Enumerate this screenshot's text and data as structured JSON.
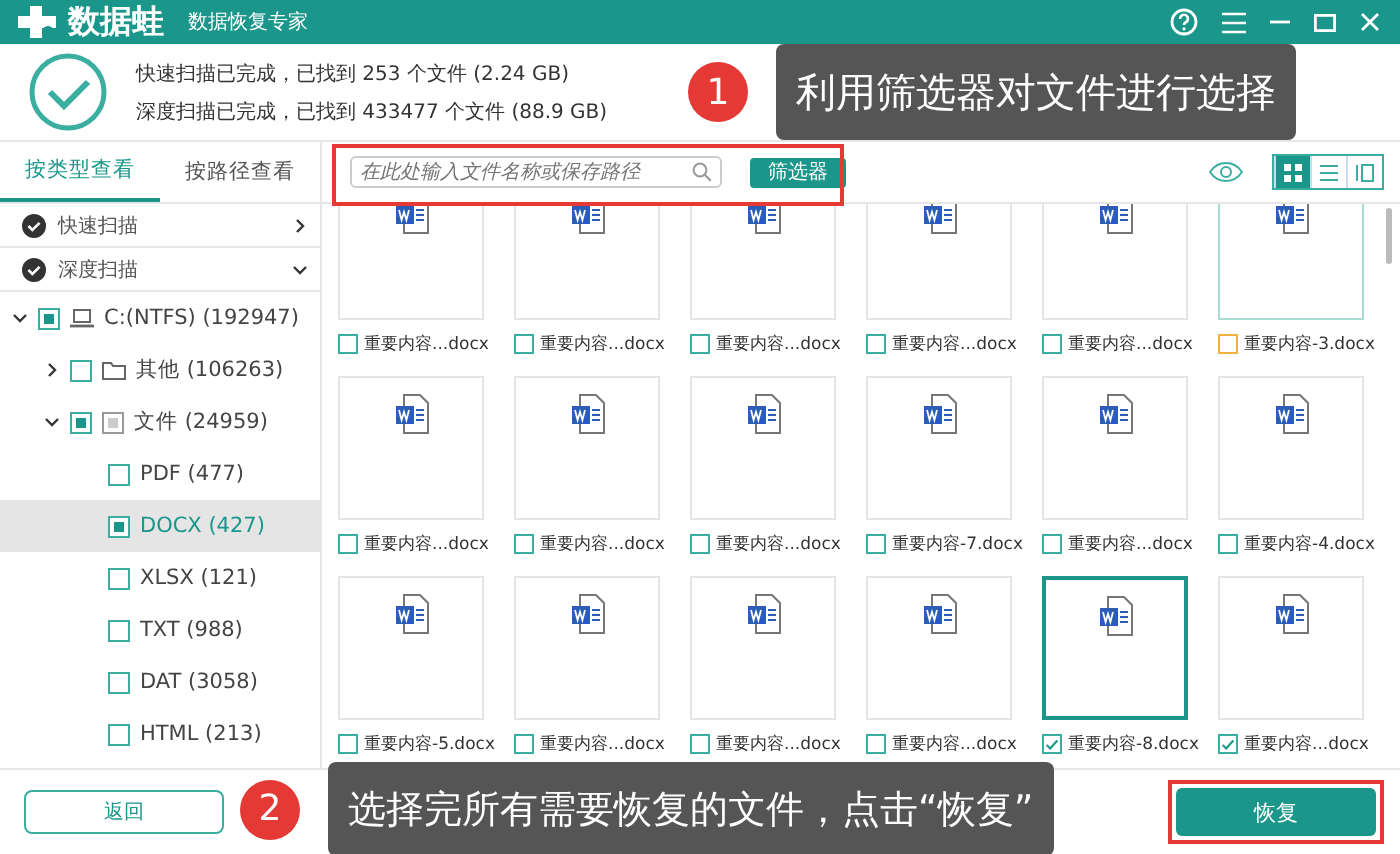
{
  "app": {
    "name": "数据蛙",
    "subtitle": "数据恢复专家"
  },
  "scan_status": [
    "快速扫描已完成，已找到 253 个文件 (2.24 GB)",
    "深度扫描已完成，已找到 433477 个文件 (88.9 GB)"
  ],
  "sidebar": {
    "tabs": [
      {
        "label": "按类型查看",
        "selected": true
      },
      {
        "label": "按路径查看",
        "selected": false
      }
    ],
    "scans": [
      {
        "label": "快速扫描",
        "expanded": false
      },
      {
        "label": "深度扫描",
        "expanded": true
      }
    ],
    "tree": [
      {
        "label": "C:(NTFS) (192947)",
        "kind": "drive",
        "checked": true,
        "expanded": true,
        "selected": false,
        "children": [
          {
            "label": "其他 (106263)",
            "kind": "folder",
            "checked": false,
            "expanded": false,
            "selected": false
          },
          {
            "label": "文件 (24959)",
            "kind": "files",
            "checked": true,
            "expanded": true,
            "selected": false,
            "children": [
              {
                "label": "PDF (477)",
                "checked": false,
                "selected": false
              },
              {
                "label": "DOCX (427)",
                "checked": true,
                "selected": true
              },
              {
                "label": "XLSX (121)",
                "checked": false,
                "selected": false
              },
              {
                "label": "TXT (988)",
                "checked": false,
                "selected": false
              },
              {
                "label": "DAT (3058)",
                "checked": false,
                "selected": false
              },
              {
                "label": "HTML (213)",
                "checked": false,
                "selected": false
              }
            ]
          }
        ]
      }
    ]
  },
  "search": {
    "placeholder": "在此处输入文件名称或保存路径"
  },
  "filter_button": "筛选器",
  "views": [
    {
      "kind": "grid",
      "selected": true
    },
    {
      "kind": "list",
      "selected": false
    },
    {
      "kind": "detail",
      "selected": false
    }
  ],
  "files": [
    {
      "name": "重要内容...docx",
      "checked": false,
      "selected": false,
      "hovered": false
    },
    {
      "name": "重要内容...docx",
      "checked": false,
      "selected": false,
      "hovered": false
    },
    {
      "name": "重要内容...docx",
      "checked": false,
      "selected": false,
      "hovered": false
    },
    {
      "name": "重要内容...docx",
      "checked": false,
      "selected": false,
      "hovered": false
    },
    {
      "name": "重要内容...docx",
      "checked": false,
      "selected": false,
      "hovered": false
    },
    {
      "name": "重要内容-3.docx",
      "checked": false,
      "selected": false,
      "hovered": true
    },
    {
      "name": "重要内容...docx",
      "checked": false,
      "selected": false,
      "hovered": false
    },
    {
      "name": "重要内容...docx",
      "checked": false,
      "selected": false,
      "hovered": false
    },
    {
      "name": "重要内容...docx",
      "checked": false,
      "selected": false,
      "hovered": false
    },
    {
      "name": "重要内容-7.docx",
      "checked": false,
      "selected": false,
      "hovered": false
    },
    {
      "name": "重要内容...docx",
      "checked": false,
      "selected": false,
      "hovered": false
    },
    {
      "name": "重要内容-4.docx",
      "checked": false,
      "selected": false,
      "hovered": false
    },
    {
      "name": "重要内容-5.docx",
      "checked": false,
      "selected": false,
      "hovered": false
    },
    {
      "name": "重要内容...docx",
      "checked": false,
      "selected": false,
      "hovered": false
    },
    {
      "name": "重要内容...docx",
      "checked": false,
      "selected": false,
      "hovered": false
    },
    {
      "name": "重要内容...docx",
      "checked": false,
      "selected": false,
      "hovered": false
    },
    {
      "name": "重要内容-8.docx",
      "checked": true,
      "selected": true,
      "hovered": false
    },
    {
      "name": "重要内容...docx",
      "checked": true,
      "selected": false,
      "hovered": false
    }
  ],
  "back_button": "返回",
  "recover_button": "恢复",
  "callouts": [
    {
      "number": "1",
      "text": "利用筛选器对文件进行选择"
    },
    {
      "number": "2",
      "text": "选择完所有需要恢复的文件，点击“恢复”"
    }
  ]
}
